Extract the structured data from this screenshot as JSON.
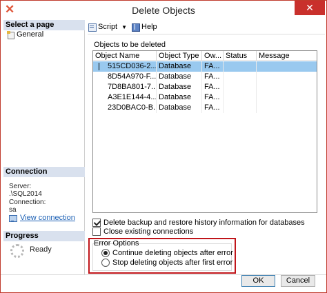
{
  "window": {
    "title": "Delete Objects",
    "close_glyph": "✕",
    "app_icon": "✕"
  },
  "left_panel": {
    "select_page_header": "Select a page",
    "pages": [
      {
        "label": "General",
        "icon": "page-icon"
      }
    ],
    "connection_header": "Connection",
    "server_label": "Server:",
    "server_value": ".\\SQL2014",
    "connection_label": "Connection:",
    "connection_value": "sa",
    "view_connection_link": "View connection",
    "progress_header": "Progress",
    "progress_status": "Ready"
  },
  "toolbar": {
    "script_label": "Script",
    "script_dropdown": "▼",
    "help_label": "Help"
  },
  "objects": {
    "label": "Objects to be deleted",
    "columns": [
      "Object Name",
      "Object Type",
      "Ow...",
      "Status",
      "Message"
    ],
    "rows": [
      {
        "name": "515CD036-2...",
        "type": "Database",
        "owner": "FA...",
        "status": "",
        "message": "",
        "selected": true
      },
      {
        "name": "8D54A970-F...",
        "type": "Database",
        "owner": "FA...",
        "status": "",
        "message": "",
        "selected": false
      },
      {
        "name": "7D8BA801-7...",
        "type": "Database",
        "owner": "FA...",
        "status": "",
        "message": "",
        "selected": false
      },
      {
        "name": "A3E1E144-4...",
        "type": "Database",
        "owner": "FA...",
        "status": "",
        "message": "",
        "selected": false
      },
      {
        "name": "23D0BAC0-B...",
        "type": "Database",
        "owner": "FA...",
        "status": "",
        "message": "",
        "selected": false
      }
    ]
  },
  "options": {
    "delete_backup_label": "Delete backup and restore history information for databases",
    "delete_backup_checked": true,
    "close_connections_label": "Close existing connections",
    "close_connections_checked": false
  },
  "error_options": {
    "legend": "Error Options",
    "continue_label": "Continue deleting objects after error",
    "stop_label": "Stop deleting objects after first error",
    "selected": "continue"
  },
  "buttons": {
    "ok": "OK",
    "cancel": "Cancel"
  },
  "colors": {
    "highlight": "#c0151a",
    "selection": "#99c9ef",
    "header_band": "#d9e1ee",
    "close_button": "#c9302c"
  }
}
